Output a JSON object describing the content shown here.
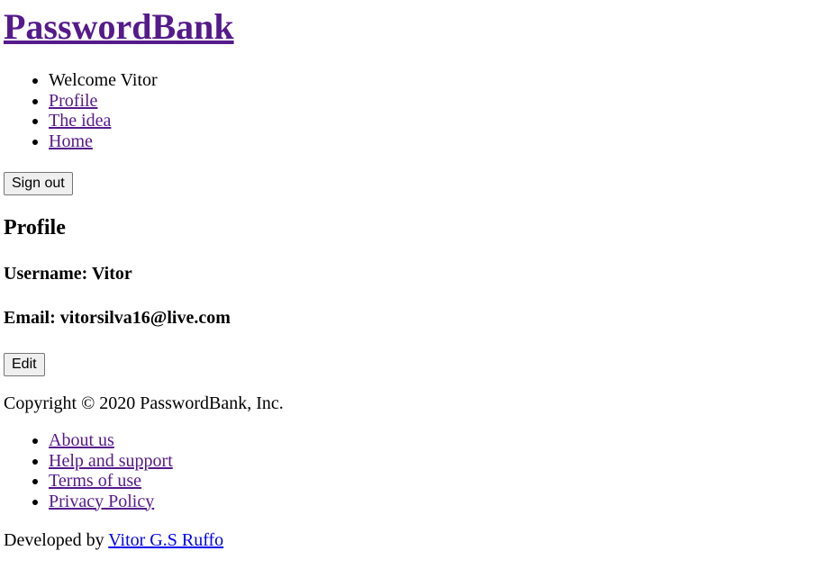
{
  "header": {
    "title": "PasswordBank"
  },
  "nav": {
    "welcome": "Welcome Vitor",
    "items": [
      {
        "label": "Profile"
      },
      {
        "label": "The idea"
      },
      {
        "label": "Home"
      }
    ],
    "signout_label": "Sign out"
  },
  "profile": {
    "heading": "Profile",
    "username_label": "Username:",
    "username_value": "Vitor",
    "email_label": "Email:",
    "email_value": "vitorsilva16@live.com",
    "edit_label": "Edit"
  },
  "footer": {
    "copyright": "Copyright © 2020 PasswordBank, Inc.",
    "links": [
      {
        "label": "About us"
      },
      {
        "label": "Help and support"
      },
      {
        "label": "Terms of use"
      },
      {
        "label": "Privacy Policy"
      }
    ],
    "developed_prefix": "Developed by",
    "developer_name": "Vitor G.S Ruffo"
  },
  "colors": {
    "visited_link": "#551a8b",
    "unvisited_link": "#0000ee",
    "button_bg": "#efefef"
  }
}
